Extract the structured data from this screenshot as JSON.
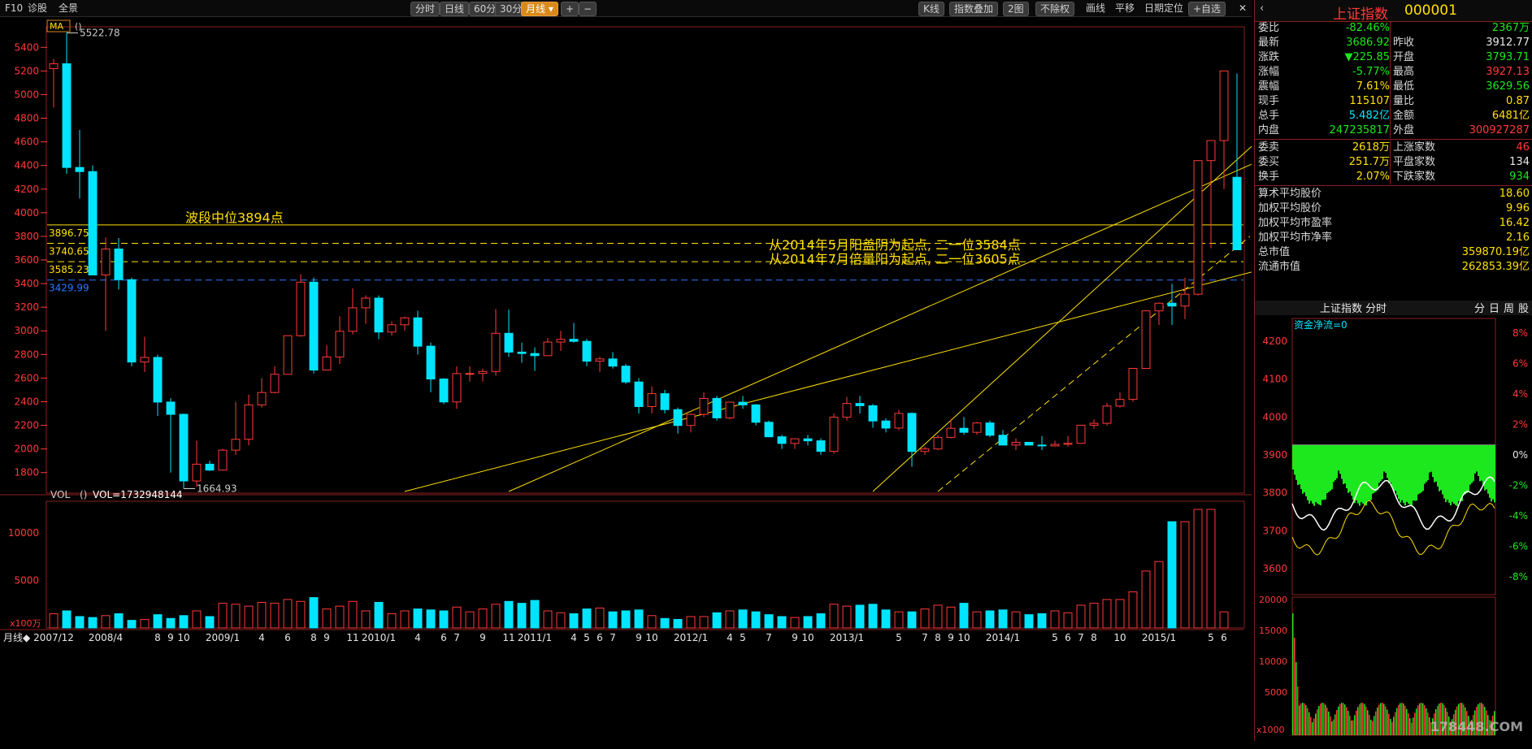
{
  "toolbar": {
    "left_items": [
      "F10",
      "诊股",
      "全景"
    ],
    "period_tabs": [
      "分时",
      "日线",
      "60分",
      "30分",
      "月线"
    ],
    "active_period": "月线",
    "zoom_in": "+",
    "zoom_out": "−",
    "right_items": [
      "K线",
      "指数叠加",
      "2图",
      "不除权",
      "画线",
      "平移",
      "日期定位",
      "+自选"
    ],
    "nav_back": "◀",
    "close": "✕"
  },
  "chart_data": {
    "type": "candlestick",
    "indicator_label": "MA",
    "indicator_param": "()",
    "x_categories": [
      "2007/12",
      "2008/1",
      "2008/2",
      "2008/3",
      "2008/4",
      "2008/5",
      "2008/6",
      "2008/7",
      "2008/8",
      "2008/9",
      "2008/10",
      "2008/11",
      "2008/12",
      "2009/1",
      "2009/2",
      "2009/3",
      "2009/4",
      "2009/5",
      "2009/6",
      "2009/7",
      "2009/8",
      "2009/9",
      "2009/10",
      "2009/11",
      "2009/12",
      "2010/1",
      "2010/2",
      "2010/3",
      "2010/4",
      "2010/5",
      "2010/6",
      "2010/7",
      "2010/8",
      "2010/9",
      "2010/10",
      "2010/11",
      "2010/12",
      "2011/1",
      "2011/2",
      "2011/3",
      "2011/4",
      "2011/5",
      "2011/6",
      "2011/7",
      "2011/8",
      "2011/9",
      "2011/10",
      "2011/11",
      "2011/12",
      "2012/1",
      "2012/2",
      "2012/3",
      "2012/4",
      "2012/5",
      "2012/6",
      "2012/7",
      "2012/8",
      "2012/9",
      "2012/10",
      "2012/11",
      "2012/12",
      "2013/1",
      "2013/2",
      "2013/3",
      "2013/4",
      "2013/5",
      "2013/6",
      "2013/7",
      "2013/8",
      "2013/9",
      "2013/10",
      "2013/11",
      "2013/12",
      "2014/1",
      "2014/2",
      "2014/3",
      "2014/4",
      "2014/5",
      "2014/6",
      "2014/7",
      "2014/8",
      "2014/9",
      "2014/10",
      "2014/11",
      "2014/12",
      "2015/1",
      "2015/2",
      "2015/3",
      "2015/4",
      "2015/5",
      "2015/6"
    ],
    "x_tick_labels": [
      "2007/12",
      "2008/4",
      "8",
      "9",
      "10",
      "2009/1",
      "4",
      "6",
      "8",
      "9",
      "11",
      "2010/1",
      "4",
      "6",
      "7",
      "9",
      "11",
      "2011/1",
      "4",
      "5",
      "6",
      "7",
      "9",
      "10",
      "2012/1",
      "4",
      "5",
      "7",
      "9",
      "10",
      "2013/1",
      "5",
      "7",
      "8",
      "9",
      "10",
      "2014/1",
      "5",
      "6",
      "7",
      "8",
      "10",
      "2015/1",
      "5",
      "6"
    ],
    "y_ticks": [
      1800,
      2000,
      2200,
      2400,
      2600,
      2800,
      3000,
      3200,
      3400,
      3600,
      3800,
      4000,
      4200,
      4400,
      4600,
      4800,
      5000,
      5200,
      5400
    ],
    "y_range": [
      1640,
      5560
    ],
    "ohlc": [
      [
        5220,
        5300,
        4890,
        5261
      ],
      [
        5261,
        5522,
        4330,
        4383
      ],
      [
        4383,
        4700,
        4120,
        4348
      ],
      [
        4348,
        4400,
        3500,
        3473
      ],
      [
        3473,
        3790,
        3000,
        3693
      ],
      [
        3693,
        3786,
        3350,
        3433
      ],
      [
        3433,
        3450,
        2700,
        2736
      ],
      [
        2736,
        2950,
        2650,
        2775
      ],
      [
        2775,
        2800,
        2280,
        2397
      ],
      [
        2397,
        2430,
        1800,
        2293
      ],
      [
        2293,
        2300,
        1664,
        1729
      ],
      [
        1729,
        2070,
        1680,
        1871
      ],
      [
        1871,
        1900,
        1814,
        1821
      ],
      [
        1821,
        2000,
        1840,
        1990
      ],
      [
        1990,
        2400,
        1950,
        2082
      ],
      [
        2082,
        2460,
        2030,
        2373
      ],
      [
        2373,
        2600,
        2350,
        2478
      ],
      [
        2478,
        2700,
        2470,
        2632
      ],
      [
        2632,
        2960,
        2630,
        2959
      ],
      [
        2959,
        3478,
        2950,
        3412
      ],
      [
        3412,
        3450,
        2640,
        2668
      ],
      [
        2668,
        2880,
        2700,
        2779
      ],
      [
        2779,
        3123,
        2720,
        2996
      ],
      [
        2996,
        3360,
        2970,
        3195
      ],
      [
        3195,
        3300,
        3060,
        3277
      ],
      [
        3277,
        3300,
        2930,
        2990
      ],
      [
        2990,
        3080,
        2960,
        3051
      ],
      [
        3051,
        3120,
        3000,
        3110
      ],
      [
        3110,
        3170,
        2800,
        2870
      ],
      [
        2870,
        2900,
        2480,
        2592
      ],
      [
        2592,
        2600,
        2380,
        2398
      ],
      [
        2398,
        2700,
        2340,
        2638
      ],
      [
        2638,
        2700,
        2570,
        2639
      ],
      [
        2639,
        2680,
        2570,
        2656
      ],
      [
        2656,
        3185,
        2620,
        2979
      ],
      [
        2979,
        3180,
        2780,
        2820
      ],
      [
        2820,
        2900,
        2730,
        2808
      ],
      [
        2808,
        2860,
        2660,
        2790
      ],
      [
        2790,
        2940,
        2790,
        2905
      ],
      [
        2905,
        3000,
        2830,
        2928
      ],
      [
        2928,
        3067,
        2900,
        2911
      ],
      [
        2911,
        2930,
        2700,
        2743
      ],
      [
        2743,
        2780,
        2650,
        2762
      ],
      [
        2762,
        2820,
        2680,
        2701
      ],
      [
        2701,
        2720,
        2550,
        2567
      ],
      [
        2567,
        2600,
        2300,
        2359
      ],
      [
        2359,
        2530,
        2300,
        2468
      ],
      [
        2468,
        2500,
        2300,
        2333
      ],
      [
        2333,
        2350,
        2130,
        2199
      ],
      [
        2199,
        2300,
        2140,
        2293
      ],
      [
        2293,
        2480,
        2270,
        2428
      ],
      [
        2428,
        2450,
        2240,
        2263
      ],
      [
        2263,
        2400,
        2250,
        2396
      ],
      [
        2396,
        2450,
        2340,
        2373
      ],
      [
        2373,
        2380,
        2200,
        2226
      ],
      [
        2226,
        2240,
        2100,
        2103
      ],
      [
        2103,
        2120,
        2000,
        2047
      ],
      [
        2047,
        2090,
        2000,
        2086
      ],
      [
        2086,
        2120,
        2030,
        2069
      ],
      [
        2069,
        2090,
        1950,
        1980
      ],
      [
        1980,
        2300,
        1960,
        2269
      ],
      [
        2269,
        2440,
        2240,
        2385
      ],
      [
        2385,
        2450,
        2300,
        2366
      ],
      [
        2366,
        2380,
        2180,
        2237
      ],
      [
        2237,
        2260,
        2140,
        2177
      ],
      [
        2177,
        2330,
        2160,
        2301
      ],
      [
        2301,
        2310,
        1850,
        1979
      ],
      [
        1979,
        2020,
        1950,
        2000
      ],
      [
        2000,
        2120,
        1990,
        2098
      ],
      [
        2098,
        2250,
        2090,
        2175
      ],
      [
        2175,
        2270,
        2120,
        2141
      ],
      [
        2141,
        2230,
        2120,
        2220
      ],
      [
        2220,
        2240,
        2100,
        2116
      ],
      [
        2116,
        2160,
        2030,
        2033
      ],
      [
        2033,
        2090,
        1990,
        2056
      ],
      [
        2056,
        2060,
        2030,
        2033
      ],
      [
        2033,
        2110,
        1990,
        2026
      ],
      [
        2026,
        2070,
        2020,
        2039
      ],
      [
        2039,
        2110,
        2020,
        2048
      ],
      [
        2048,
        2190,
        2050,
        2201
      ],
      [
        2201,
        2250,
        2170,
        2217
      ],
      [
        2217,
        2390,
        2200,
        2363
      ],
      [
        2363,
        2480,
        2350,
        2420
      ],
      [
        2420,
        2500,
        2400,
        2682
      ],
      [
        2682,
        3090,
        2680,
        3169
      ],
      [
        3169,
        3240,
        3050,
        3234
      ],
      [
        3234,
        3400,
        3050,
        3210
      ],
      [
        3210,
        3450,
        3100,
        3310
      ],
      [
        3310,
        4430,
        3300,
        4441
      ],
      [
        4441,
        4600,
        3700,
        4611
      ],
      [
        4611,
        4990,
        4200,
        5200
      ],
      [
        4300,
        5178,
        3900,
        3686
      ]
    ],
    "volume_series_name": "VOL",
    "volume_param": "()",
    "volume_readout": "VOL=1732948144",
    "volume_unit": "x100万",
    "volume_y_ticks": [
      5000,
      10000
    ],
    "volume": [
      1500,
      1800,
      1200,
      1100,
      1300,
      1500,
      800,
      900,
      1400,
      1000,
      1300,
      1800,
      1200,
      2600,
      2500,
      2300,
      2700,
      2600,
      3000,
      2800,
      3200,
      2000,
      2300,
      2800,
      1800,
      2700,
      1500,
      1800,
      2000,
      1900,
      1800,
      2200,
      1700,
      2000,
      2500,
      2800,
      2600,
      2900,
      1800,
      1600,
      1500,
      2000,
      2100,
      1700,
      1800,
      1900,
      1300,
      1000,
      900,
      1200,
      1200,
      1600,
      1800,
      1900,
      1700,
      1400,
      1200,
      1100,
      1200,
      1500,
      2500,
      2300,
      2400,
      2500,
      1900,
      1700,
      1700,
      2000,
      2400,
      2200,
      2600,
      1700,
      1800,
      1900,
      1700,
      1400,
      1500,
      1800,
      1600,
      2400,
      2600,
      3000,
      3000,
      3800,
      6000,
      7000,
      11200,
      11200,
      12500,
      12500,
      1700
    ],
    "annotations": [
      {
        "text": "5522.78",
        "kind": "high"
      },
      {
        "text": "1664.93",
        "kind": "low"
      },
      {
        "text": "波段中位3894点",
        "value": 3894
      },
      {
        "text": "从2014年5月阳盖阴为起点, 二一位3584点"
      },
      {
        "text": "从2014年7月倍量阳为起点, 二一位3605点"
      }
    ],
    "h_lines": [
      {
        "value": 3896.75,
        "label": "3896.75",
        "style": "solid",
        "color": "#ffe000"
      },
      {
        "value": 3740.65,
        "label": "3740.65",
        "style": "dashed",
        "color": "#ffe000"
      },
      {
        "value": 3585.23,
        "label": "3585.23",
        "style": "dashed",
        "color": "#ffe000"
      },
      {
        "value": 3429.99,
        "label": "3429.99",
        "style": "dashed",
        "color": "#2a7bff"
      }
    ]
  },
  "right_panel": {
    "title": "上证指数",
    "code": "000001",
    "rows1": [
      {
        "l": "委比",
        "v": "-82.46%",
        "vc": "green",
        "l2": "",
        "v2": "2367万",
        "v2c": "green"
      },
      {
        "l": "最新",
        "v": "3686.92",
        "vc": "green",
        "l2": "昨收",
        "v2": "3912.77",
        "v2c": "white"
      },
      {
        "l": "涨跌",
        "v": "▼225.85",
        "vc": "green",
        "l2": "开盘",
        "v2": "3793.71",
        "v2c": "green"
      },
      {
        "l": "涨幅",
        "v": "-5.77%",
        "vc": "green",
        "l2": "最高",
        "v2": "3927.13",
        "v2c": "red"
      },
      {
        "l": "震幅",
        "v": "7.61%",
        "vc": "yellow",
        "l2": "最低",
        "v2": "3629.56",
        "v2c": "green"
      },
      {
        "l": "现手",
        "v": "115107",
        "vc": "yellow",
        "l2": "量比",
        "v2": "0.87",
        "v2c": "yellow"
      },
      {
        "l": "总手",
        "v": "5.482亿",
        "vc": "cyan",
        "l2": "金额",
        "v2": "6481亿",
        "v2c": "yellow"
      },
      {
        "l": "内盘",
        "v": "247235817",
        "vc": "green",
        "l2": "外盘",
        "v2": "300927287",
        "v2c": "red"
      }
    ],
    "rows2": [
      {
        "l": "委卖",
        "v": "2618万",
        "vc": "yellow",
        "l2": "上涨家数",
        "v2": "46",
        "v2c": "red"
      },
      {
        "l": "委买",
        "v": "251.7万",
        "vc": "yellow",
        "l2": "平盘家数",
        "v2": "134",
        "v2c": "white"
      },
      {
        "l": "换手",
        "v": "2.07%",
        "vc": "yellow",
        "l2": "下跌家数",
        "v2": "934",
        "v2c": "green"
      }
    ],
    "rows3": [
      {
        "l": "算术平均股价",
        "v": "18.60",
        "vc": "yellow"
      },
      {
        "l": "加权平均股价",
        "v": "9.96",
        "vc": "yellow"
      },
      {
        "l": "加权平均市盈率",
        "v": "16.42",
        "vc": "yellow"
      },
      {
        "l": "加权平均市净率",
        "v": "2.16",
        "vc": "yellow"
      },
      {
        "l": "总市值",
        "v": "359870.19亿",
        "vc": "yellow"
      },
      {
        "l": "流通市值",
        "v": "262853.39亿",
        "vc": "yellow"
      }
    ],
    "mini_title": "上证指数 分时",
    "mini_tabs": [
      "分",
      "日",
      "周",
      "股"
    ],
    "flow_label": "资金净流=0",
    "mini_y_left": [
      "4200",
      "4100",
      "4000",
      "3900",
      "3800",
      "3700",
      "3600"
    ],
    "mini_y_right": [
      "8%",
      "6%",
      "4%",
      "2%",
      "0%",
      "-2%",
      "-4%",
      "-6%",
      "-8%"
    ],
    "mini_vol_ticks": [
      "20000",
      "15000",
      "10000",
      "5000"
    ],
    "mini_vol_unit": "x1000",
    "watermark": "178448.COM"
  },
  "bottom": {
    "period_label": "月线◆"
  },
  "colors": {
    "up": "#ff3a3a",
    "down": "#00e5ff",
    "line": "#ffe000",
    "grid": "#8a1f1f"
  }
}
